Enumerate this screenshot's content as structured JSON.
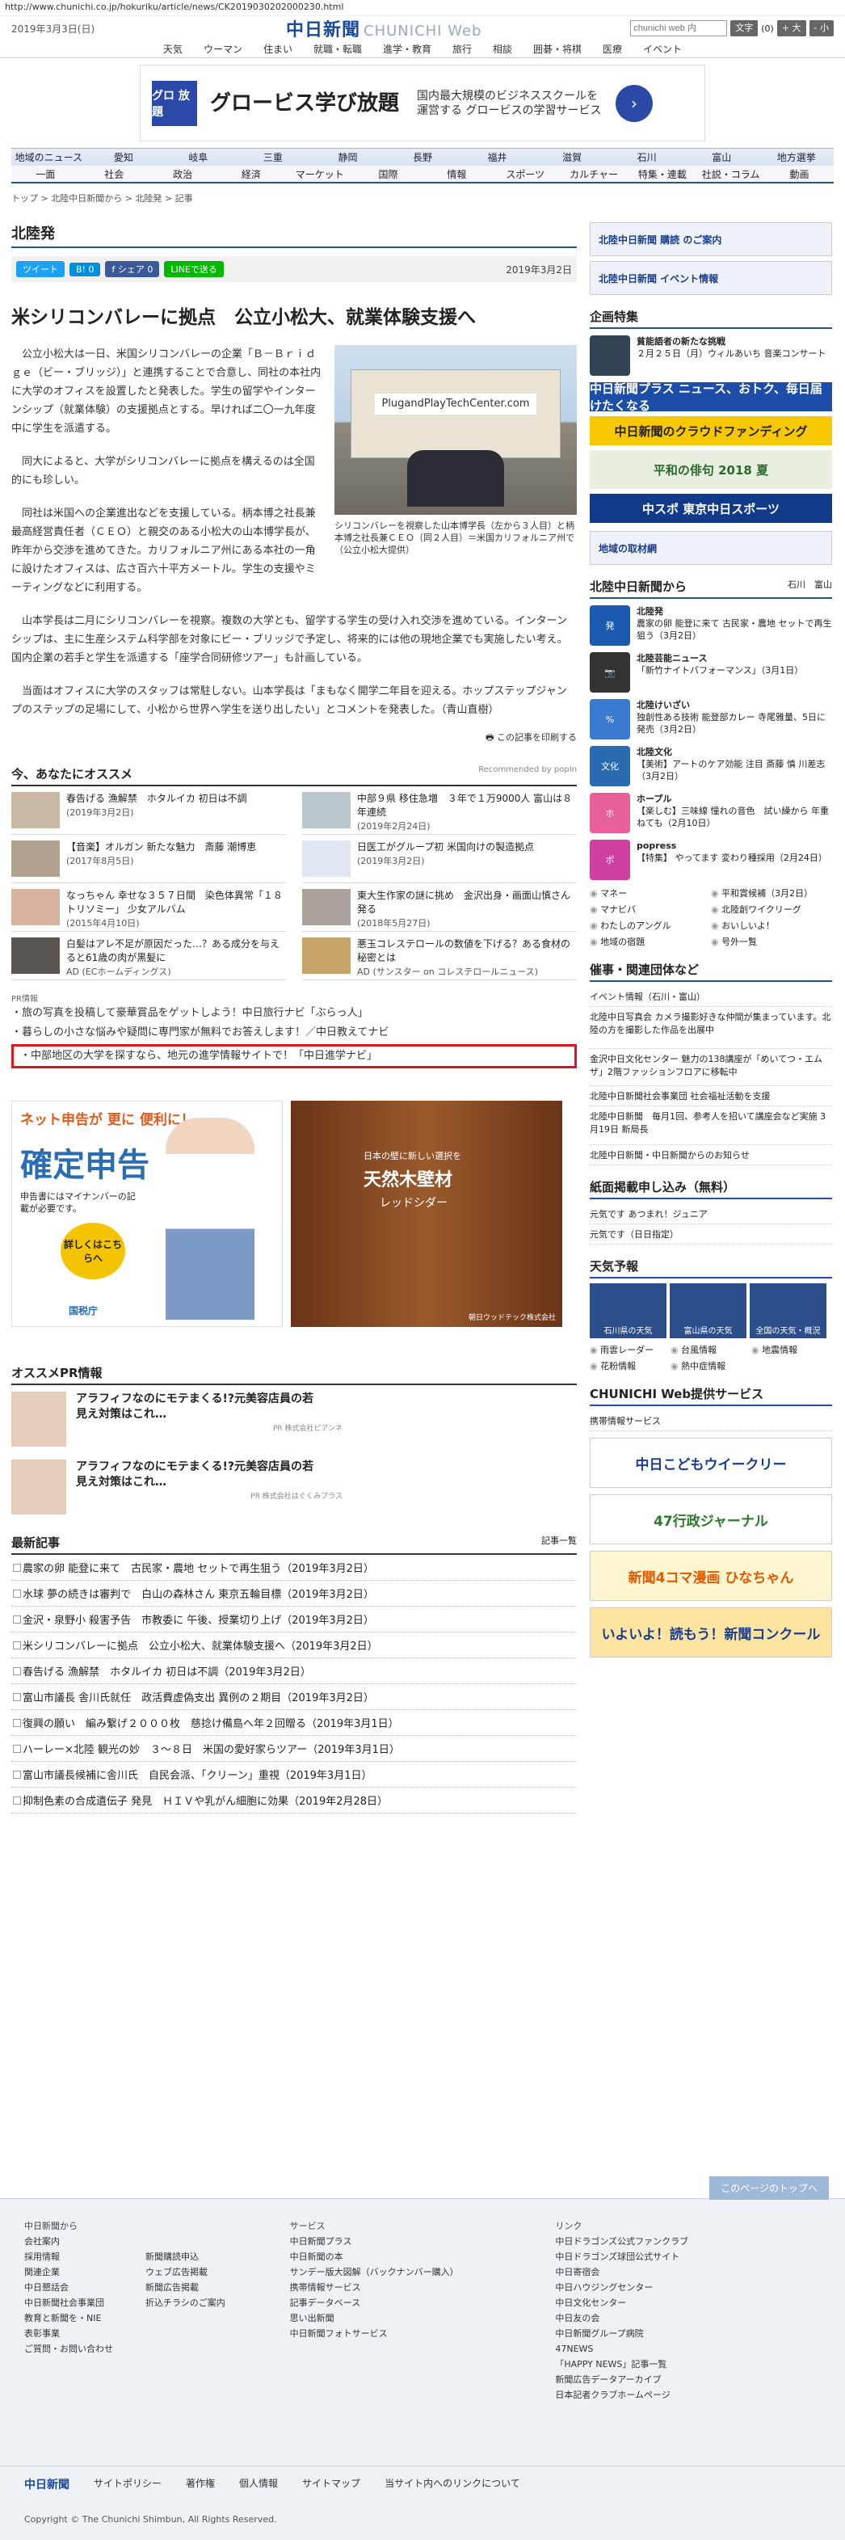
{
  "url": "http://www.chunichi.co.jp/hokuriku/article/news/CK2019030202000230.html",
  "header": {
    "date": "2019年3月3日(日)",
    "logo": "中日新聞",
    "logo_web": "CHUNICHI Web",
    "search_placeholder": "chunichi web 内",
    "search_button": "文字",
    "font_label": "(0)",
    "font_larger": "+ 大",
    "font_smaller": "- 小"
  },
  "gnav": [
    "天気",
    "ウーマン",
    "住まい",
    "就職・転職",
    "進学・教育",
    "旅行",
    "相談",
    "囲碁・将棋",
    "医療",
    "イベント"
  ],
  "banner": {
    "icon": "グロ 放題",
    "headline": "グロービス学び放題",
    "desc": "国内最大規模のビジネススクールを運営する グロービスの学習サービス"
  },
  "region_nav": [
    "地域のニュース",
    "愛知",
    "岐阜",
    "三重",
    "静岡",
    "長野",
    "福井",
    "滋賀",
    "石川",
    "富山",
    "地方選挙"
  ],
  "cat_nav": [
    "一面",
    "社会",
    "政治",
    "経済",
    "マーケット",
    "国際",
    "情報",
    "スポーツ",
    "カルチャー",
    "特集・連載",
    "社説・コラム",
    "動画"
  ],
  "breadcrumb": "トップ > 北陸中日新聞から > 北陸発 > 記事",
  "section_title": "北陸発",
  "social": {
    "tweet": "ツイート",
    "hatena": "B! 0",
    "share": "f シェア 0",
    "line": "LINEで送る",
    "pubdate": "2019年3月2日"
  },
  "article": {
    "title": "米シリコンバレーに拠点　公立小松大、就業体験支援へ",
    "paragraphs": [
      "公立小松大は一日、米国シリコンバレーの企業「Ｂ－Ｂｒｉｄｇｅ（ビー・ブリッジ）」と連携することで合意し、同社の本社内に大学のオフィスを設置したと発表した。学生の留学やインターンシップ（就業体験）の支援拠点とする。早ければ二〇一九年度中に学生を派遣する。",
      "同大によると、大学がシリコンバレーに拠点を構えるのは全国的にも珍しい。",
      "同社は米国への企業進出などを支援している。柄本博之社長兼最高経営責任者（ＣＥＯ）と親交のある小松大の山本博学長が、昨年から交渉を進めてきた。カリフォルニア州にある本社の一角に設けたオフィスは、広さ百六十平方メートル。学生の支援やミーティングなどに利用する。",
      "山本学長は二月にシリコンバレーを視察。複数の大学とも、留学する学生の受け入れ交渉を進めている。インターンシップは、主に生産システム科学部を対象にビー・ブリッジで予定し、将来的には他の現地企業でも実施したい考え。国内企業の若手と学生を派遣する「座学合同研修ツアー」も計画している。",
      "当面はオフィスに大学のスタッフは常駐しない。山本学長は「まもなく開学二年目を迎える。ホップステップジャンプのステップの足場にして、小松から世界へ学生を送り出したい」とコメントを発表した。（青山直樹）"
    ],
    "photo_sign": "PlugandPlayTechCenter.com",
    "caption": "シリコンバレーを視察した山本博学長（左から３人目）と柄本博之社長兼ＣＥＯ（同２人目）＝米国カリフォルニア州で（公立小松大提供）",
    "print": "この記事を印刷する"
  },
  "reco": {
    "heading": "今、あなたにオススメ",
    "powered": "Recommended by popIn",
    "items": [
      {
        "t": "春告げる 漁解禁　ホタルイカ 初日は不調",
        "d": "(2019年3月2日)"
      },
      {
        "t": "中部９県 移住急増　３年で１万9000人 富山は８年連続",
        "d": "(2019年2月24日)"
      },
      {
        "t": "【音楽】オルガン 新たな魅力　斎藤 潮博恵",
        "d": "(2017年8月5日)"
      },
      {
        "t": "日医工がグループ初 米国向けの製造拠点",
        "d": "(2019年3月2日)"
      },
      {
        "t": "なっちゃん 幸せな３５７日間　染色体異常「１８トリソミー」 少女アルバム",
        "d": "(2015年4月10日)"
      },
      {
        "t": "東大生作家の謎に挑め　金沢出身・画面山慎さん発る",
        "d": "(2018年5月27日)"
      },
      {
        "t": "白髪はアレ不足が原因だった…？ある成分を与えると61歳の肉が黒髪に",
        "d": "AD (ECホームディングス)"
      },
      {
        "t": "悪玉コレステロールの数値を下げる？ある食材の秘密とは",
        "d": "AD (サンスター on コレステロールニュース)"
      }
    ]
  },
  "pr": {
    "label": "PR情報",
    "links": [
      "旅の写真を投稿して豪華賞品をゲットしよう！中日旅行ナビ「ぶらっ人」",
      "暮らしの小さな悩みや疑問に専門家が無料でお答えします！／中日教えてナビ",
      "中部地区の大学を探すなら、地元の進学情報サイトで！「中日進学ナビ」"
    ]
  },
  "ads": {
    "ad1_top": "ネット申告が 更に 便利に！",
    "ad1_main": "確定申告",
    "ad1_sub": "申告書にはマイナンバーの記載が必要です。",
    "ad1_btn": "詳しくはこちらへ",
    "ad1_org": "国税庁",
    "ad2_top": "日本の壁に新しい選択を",
    "ad2_main": "天然木壁材",
    "ad2_sub": "レッドシダー",
    "ad2_org": "朝日ウッドテック株式会社"
  },
  "osusume_pr": {
    "heading": "オススメPR情報",
    "items": [
      {
        "t": "アラフィフなのにモテまくる!?元美容店員の若見え対策はこれ…",
        "p": "PR 株式会社ピアンネ"
      },
      {
        "t": "アラフィフなのにモテまくる!?元美容店員の若見え対策はこれ…",
        "p": "PR 株式会社はぐくみプラス"
      }
    ]
  },
  "latest": {
    "heading": "最新記事",
    "more": "記事一覧",
    "items": [
      "農家の卵 能登に来て　古民家・農地 セットで再生狙う（2019年3月2日）",
      "水球 夢の続きは審判で　白山の森林さん 東京五輪目標（2019年3月2日）",
      "金沢・泉野小 殺害予告　市教委に 午後、授業切り上げ（2019年3月2日）",
      "米シリコンバレーに拠点　公立小松大、就業体験支援へ（2019年3月2日）",
      "春告げる 漁解禁　ホタルイカ 初日は不調（2019年3月2日）",
      "富山市議長 舎川氏就任　政活費虚偽支出 異例の２期目（2019年3月2日）",
      "復興の願い　編み繋げ２０００枚　慈捻け備島へ年２回贈る（2019年3月1日）",
      "ハーレー×北陸 観光の妙　３～８日　米国の愛好家らツアー（2019年3月1日）",
      "富山市議長候補に舎川氏　自民会派、「クリーン」重視（2019年3月1日）",
      "抑制色素の合成遺伝子 発見　ＨＩＶや乳がん細胞に効果（2019年2月28日）"
    ]
  },
  "side": {
    "subscribe": "北陸中日新聞 購読 のご案内",
    "event": "北陸中日新聞 イベント情報",
    "kikaku": "企画特集",
    "kikaku_item": {
      "t": "貧能語者の新たな挑戦",
      "d": "２月２５日（月）ウィルあいち 音楽コンサート"
    },
    "banners": [
      "中日新聞プラス ニュース、おトク、毎日届けたくなる",
      "中日新聞のクラウドファンディング",
      "平和の俳句 2018 夏",
      "中スポ 東京中日スポーツ"
    ],
    "torizai": "地域の取材網",
    "hokuriku_h": "北陸中日新聞から",
    "hokuriku_tabs": [
      "石川",
      "富山"
    ],
    "hokuriku_items": [
      {
        "b": "北陸発",
        "t": "農家の卵 能登に来て 古民家・農地 セットで再生狙う（3月2日）"
      },
      {
        "b": "北陸芸能ニュース",
        "t": "「新竹ナイトパフォーマンス」（3月1日）"
      },
      {
        "b": "北陸けいざい",
        "t": "独創性ある技術 能登部カレー 寺尾雅量、5日に発売（3月2日）"
      },
      {
        "b": "北陸文化",
        "t": "【美術】アートのケア効能 注目 斎藤 慎 川差志（3月2日）"
      },
      {
        "b": "ホープル",
        "t": "【楽しむ】三味線 憧れの音色　試い繰から 年重ねても（2月10日）"
      },
      {
        "b": "popress",
        "t": "【特集】 やってます 変わり種採用（2月24日）"
      }
    ],
    "tags": [
      "マネー",
      "平和賞候補（3月2日）",
      "マナビバ",
      "北陸創ワイクリーグ",
      "わたしのアングル",
      "おいしいよ！",
      "地域の宿題",
      "号外一覧"
    ],
    "kigyo": "催事・関連団体など",
    "kigyo_link": "イベント情報（石川・富山）",
    "kigyo_items": [
      "北陸中日写真会 カメラ撮影好きな仲間が集まっています。北陸の方を撮影した作品を出展中",
      "金沢中日文化センター 魅力の138講座が「めいてつ・エムザ」2階ファッションフロアに移転中",
      "北陸中日新聞社会事業団 社会福祉活動を支援",
      "北陸中日新聞　毎月1回、参考人を招いて講座会など実施 3月19日 新局長",
      "北陸中日新聞・中日新聞からのお知らせ"
    ],
    "mousikomi": "紙面掲載申し込み（無料）",
    "mousikomi_items": [
      "元気です あつまれ！ジュニア",
      "元気です（日日指定）"
    ],
    "weather_h": "天気予報",
    "weather": [
      "石川県の天気",
      "富山県の天気",
      "全国の天気・概況"
    ],
    "weather_links": [
      "雨雲レーダー",
      "台風情報",
      "地震情報",
      "花粉情報",
      "熱中症情報"
    ],
    "service_h": "CHUNICHI Web提供サービス",
    "service_link": "携帯情報サービス",
    "services": [
      "中日こどもウイークリー",
      "47行政ジャーナル",
      "新聞4コマ漫画 ひなちゃん",
      "いよいよ！読もう！新聞コンクール"
    ]
  },
  "footer": {
    "totop": "このページのトップへ",
    "col1_h": "中日新聞から",
    "col1": [
      "会社案内",
      "採用情報",
      "関連企業",
      "中日懇話会",
      "中日新聞社会事業団",
      "教育と新聞を・NIE",
      "表彰事業",
      "ご質問・お問い合わせ"
    ],
    "col1b": [
      "新聞購読申込",
      "ウェブ広告掲載",
      "新聞広告掲載",
      "折込チラシのご案内"
    ],
    "col2_h": "サービス",
    "col2": [
      "中日新聞プラス",
      "中日新聞の本",
      "サンデー版大図解（バックナンバー購入）",
      "携帯情報サービス",
      "記事データベース",
      "思い出新聞",
      "中日新聞フォトサービス"
    ],
    "col3_h": "リンク",
    "col3": [
      "中日ドラゴンズ公式ファンクラブ",
      "中日ドラゴンズ球団公式サイト",
      "中日寄宿会",
      "中日ハウジングセンター",
      "中日文化センター",
      "中日友の会",
      "中日新聞グループ病院",
      "47NEWS",
      "「HAPPY NEWS」記事一覧",
      "新聞広告データアーカイブ",
      "日本記者クラブホームページ"
    ],
    "bottom": [
      "中日新聞",
      "サイトポリシー",
      "著作権",
      "個人情報",
      "サイトマップ",
      "当サイト内へのリンクについて"
    ],
    "copyright": "Copyright © The Chunichi Shimbun, All Rights Reserved."
  }
}
